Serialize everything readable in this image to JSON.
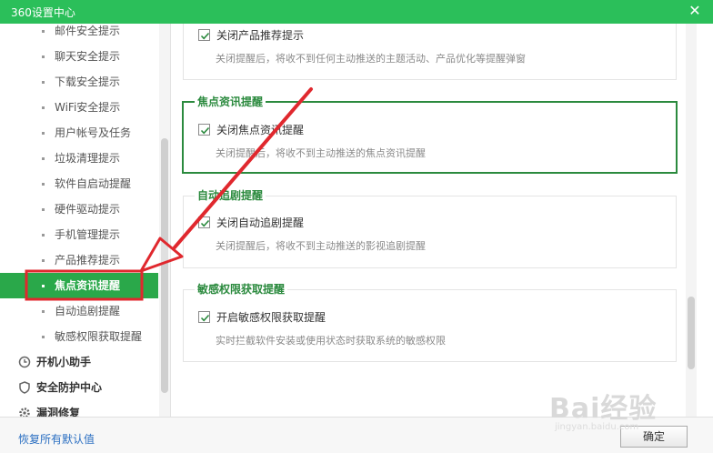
{
  "window": {
    "title": "360设置中心",
    "close_label": "✕"
  },
  "sidebar": {
    "items": [
      {
        "label": "邮件安全提示"
      },
      {
        "label": "聊天安全提示"
      },
      {
        "label": "下载安全提示"
      },
      {
        "label": "WiFi安全提示"
      },
      {
        "label": "用户帐号及任务"
      },
      {
        "label": "垃圾清理提示"
      },
      {
        "label": "软件自启动提醒"
      },
      {
        "label": "硬件驱动提示"
      },
      {
        "label": "手机管理提示"
      },
      {
        "label": "产品推荐提示"
      },
      {
        "label": "焦点资讯提醒",
        "active": true
      },
      {
        "label": "自动追剧提醒"
      },
      {
        "label": "敏感权限获取提醒"
      }
    ],
    "sections": [
      {
        "label": "开机小助手",
        "icon": "clock-icon"
      },
      {
        "label": "安全防护中心",
        "icon": "shield-icon"
      },
      {
        "label": "漏洞修复",
        "icon": "gear-icon"
      }
    ]
  },
  "groups": [
    {
      "legend": "",
      "checkbox_label": "关闭产品推荐提示",
      "checked": true,
      "description": "关闭提醒后，将收不到任何主动推送的主题活动、产品优化等提醒弹窗"
    },
    {
      "legend": "焦点资讯提醒",
      "checkbox_label": "关闭焦点资讯提醒",
      "checked": true,
      "description": "关闭提醒后，将收不到主动推送的焦点资讯提醒"
    },
    {
      "legend": "自动追剧提醒",
      "checkbox_label": "关闭自动追剧提醒",
      "checked": true,
      "description": "关闭提醒后，将收不到主动推送的影视追剧提醒"
    },
    {
      "legend": "敏感权限获取提醒",
      "checkbox_label": "开启敏感权限获取提醒",
      "checked": true,
      "description": "实时拦截软件安装或使用状态时获取系统的敏感权限"
    }
  ],
  "footer": {
    "reset_label": "恢复所有默认值",
    "ok_label": "确定"
  },
  "watermark": {
    "brand": "Bai经验",
    "url": "jingyan.baidu.com"
  },
  "colors": {
    "titlebar": "#2bbf5a",
    "accent": "#2b8a3e",
    "active_item": "#2aa84a",
    "annotation": "#e0282e"
  }
}
